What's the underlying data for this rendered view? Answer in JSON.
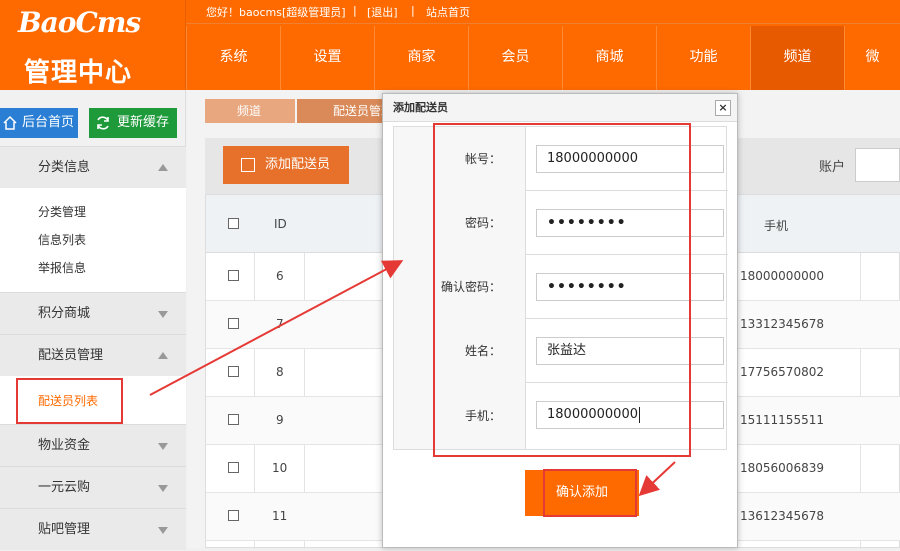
{
  "header": {
    "logo": "BaoCms",
    "logo_sub": "管理中心",
    "greeting": "您好！baocms[超级管理员]",
    "sep1": "|",
    "logout": "[退出]",
    "sep2": "|",
    "site_home": "站点首页",
    "nav": [
      "系统",
      "设置",
      "商家",
      "会员",
      "商城",
      "功能",
      "频道",
      "微"
    ]
  },
  "sidebar": {
    "home_btn": "后台首页",
    "cache_btn": "更新缓存",
    "sections": [
      {
        "label": "分类信息",
        "expanded": true,
        "items": [
          "分类管理",
          "信息列表",
          "举报信息"
        ]
      },
      {
        "label": "积分商城",
        "expanded": false,
        "items": []
      },
      {
        "label": "配送员管理",
        "expanded": true,
        "items": [
          "配送员列表"
        ]
      },
      {
        "label": "物业资金",
        "expanded": false,
        "items": []
      },
      {
        "label": "一元云购",
        "expanded": false,
        "items": []
      },
      {
        "label": "贴吧管理",
        "expanded": false,
        "items": []
      }
    ]
  },
  "breadcrumb": [
    "频道",
    "配送员管理"
  ],
  "toolbar": {
    "add_btn": "添加配送员",
    "account_label": "账户"
  },
  "table": {
    "headers": {
      "id": "ID",
      "phone": "手机"
    },
    "rows": [
      {
        "id": "6",
        "phone": "18000000000"
      },
      {
        "id": "7",
        "phone": "13312345678"
      },
      {
        "id": "8",
        "phone": "17756570802"
      },
      {
        "id": "9",
        "phone": "15111155511"
      },
      {
        "id": "10",
        "phone": "18056006839"
      },
      {
        "id": "11",
        "phone": "13612345678"
      }
    ]
  },
  "modal": {
    "title": "添加配送员",
    "close": "×",
    "fields": [
      {
        "label": "帐号：",
        "value": "18000000000"
      },
      {
        "label": "密码：",
        "value": "••••••••"
      },
      {
        "label": "确认密码：",
        "value": "••••••••"
      },
      {
        "label": "姓名：",
        "value": "张益达"
      },
      {
        "label": "手机：",
        "value": "18000000000"
      }
    ],
    "confirm_btn": "确认添加"
  },
  "colors": {
    "brand": "#ff6a00",
    "annotation": "#e53935"
  }
}
